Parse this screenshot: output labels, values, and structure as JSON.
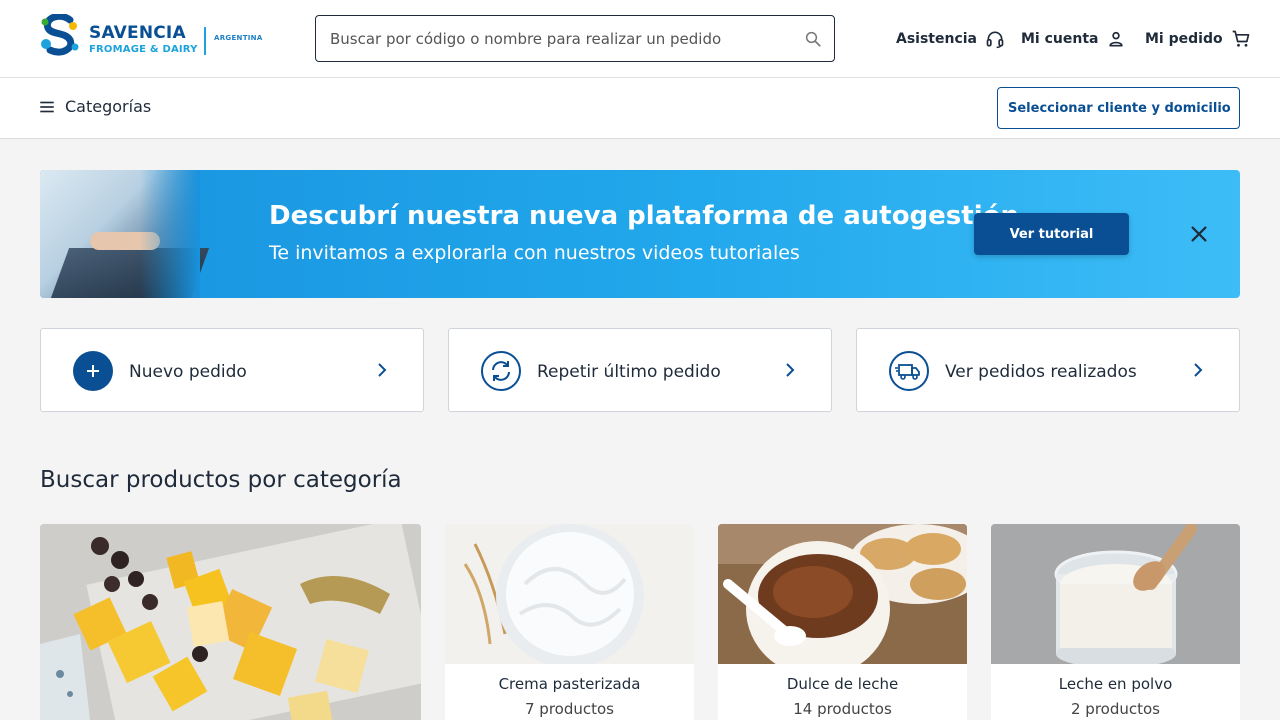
{
  "header": {
    "logo": {
      "name": "SAVENCIA",
      "sub": "FROMAGE & DAIRY",
      "country": "ARGENTINA"
    },
    "search": {
      "placeholder": "Buscar por código o nombre para realizar un pedido",
      "icon": "search-icon"
    },
    "nav": {
      "assistance_label": "Asistencia",
      "account_label": "Mi cuenta",
      "order_label": "Mi pedido"
    }
  },
  "subheader": {
    "categories_label": "Categorías",
    "select_client_label": "Seleccionar cliente y domicilio"
  },
  "banner": {
    "title": "Descubrí nuestra nueva plataforma de autogestión",
    "subtitle": "Te invitamos a explorarla con nuestros videos tutoriales",
    "button_label": "Ver tutorial"
  },
  "actions": [
    {
      "label": "Nuevo pedido",
      "icon": "plus-circle-icon"
    },
    {
      "label": "Repetir último pedido",
      "icon": "refresh-icon"
    },
    {
      "label": "Ver pedidos realizados",
      "icon": "delivery-truck-icon"
    }
  ],
  "categories": {
    "title": "Buscar productos por categoría",
    "items": [
      {
        "name": "Crema pasterizada",
        "count": "7 productos"
      },
      {
        "name": "Dulce de leche",
        "count": "14 productos"
      },
      {
        "name": "Leche en polvo",
        "count": "2 productos"
      }
    ]
  },
  "colors": {
    "brand_blue": "#0a4f94",
    "accent_light_blue": "#1ca3dd",
    "banner_gradient_start": "#1893de",
    "banner_gradient_end": "#3dbdf7"
  }
}
